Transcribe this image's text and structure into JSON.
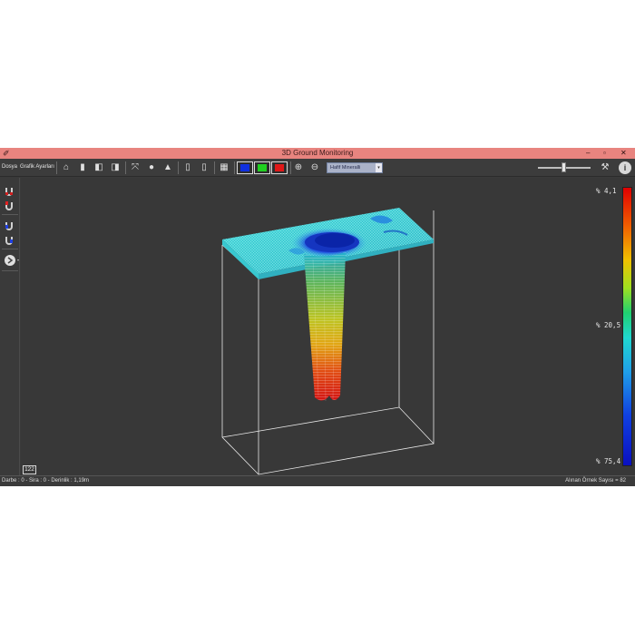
{
  "window": {
    "title": "3D Ground Monitoring",
    "controls": [
      "–",
      "▫",
      "✕"
    ]
  },
  "menu": {
    "file": "Dosya",
    "graph_settings": "Grafik Ayarları"
  },
  "toolbar": {
    "material_select": "Hafif Mineralli",
    "color_buttons": [
      "#1030e0",
      "#20d020",
      "#e01818"
    ]
  },
  "legend": {
    "top": "% 4,1",
    "middle": "% 20,5",
    "bottom": "% 75,4"
  },
  "frame_counter": "122",
  "status": {
    "left": "Darbe : 0 - Sira : 0 - Derinlik : 1,19m",
    "right": "Alınan Örnek Sayısı = 82"
  }
}
